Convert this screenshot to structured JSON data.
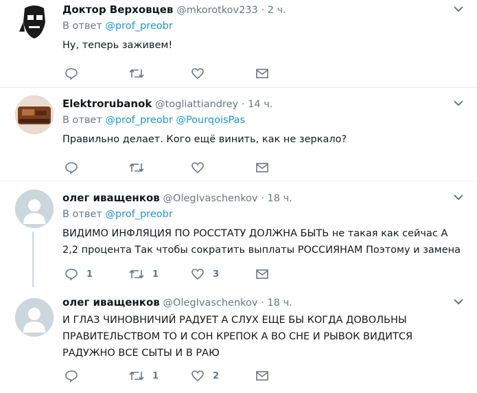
{
  "colors": {
    "link": "#1b95e0",
    "muted": "#657786",
    "text": "#14171a",
    "divider": "#e6ecf0"
  },
  "tweets": [
    {
      "name": "Доктор Верховцев",
      "handle": "@mkorotkov233",
      "time": "· 2 ч.",
      "reply_prefix": "В ответ",
      "mentions": [
        "@prof_preobr"
      ],
      "text": "Ну, теперь заживем!",
      "reply_count": "",
      "retweet_count": "",
      "like_count": ""
    },
    {
      "name": "Elektrorubanok",
      "handle": "@togliattiandrey",
      "time": "· 14 ч.",
      "reply_prefix": "В ответ",
      "mentions": [
        "@prof_preobr",
        "@PourqoisPas"
      ],
      "text": "Правильно делает. Кого ещё винить, как не зеркало?",
      "reply_count": "",
      "retweet_count": "",
      "like_count": ""
    },
    {
      "name": "олег иващенков",
      "handle": "@OlegIvaschenkov",
      "time": "· 18 ч.",
      "reply_prefix": "В ответ",
      "mentions": [
        "@prof_preobr"
      ],
      "text": "ВИДИМО ИНФЛЯЦИЯ ПО РОССТАТУ ДОЛЖНА БЫТЬ не такая как сейчас А 2,2 процента Так чтобы сократить выплаты РОССИЯНАМ Поэтому и замена",
      "reply_count": "1",
      "retweet_count": "1",
      "like_count": "3"
    },
    {
      "name": "олег иващенков",
      "handle": "@OlegIvaschenkov",
      "time": "· 18 ч.",
      "text": "И ГЛАЗ ЧИНОВНИЧИЙ РАДУЕТ А СЛУХ ЕЩЕ БЫ КОГДА ДОВОЛЬНЫ ПРАВИТЕЛЬСТВОМ ТО И СОН КРЕПОК А ВО СНЕ И РЫВОК ВИДИТСЯ РАДУЖНО ВСЕ СЫТЫ И В РАЮ",
      "reply_count": "",
      "retweet_count": "1",
      "like_count": "2"
    }
  ],
  "icons": {
    "reply": "reply-icon",
    "retweet": "retweet-icon",
    "like": "heart-icon",
    "dm": "envelope-icon",
    "caret": "chevron-down-icon"
  }
}
